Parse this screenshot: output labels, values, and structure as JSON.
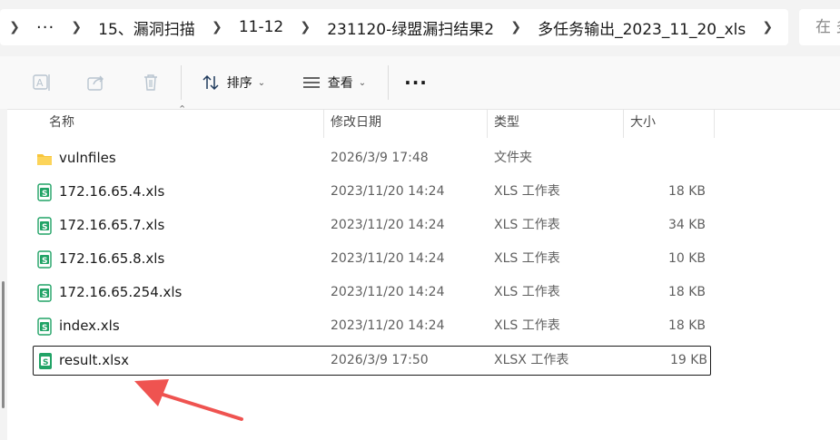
{
  "breadcrumb": {
    "overflow_label": "···",
    "segments": [
      "15、漏洞扫描",
      "11-12",
      "231120-绿盟漏扫结果2",
      "多任务输出_2023_11_20_xls"
    ],
    "search_placeholder": "在 多"
  },
  "toolbar": {
    "sort_label": "排序",
    "view_label": "查看",
    "more_label": "···"
  },
  "columns": {
    "name": "名称",
    "modified": "修改日期",
    "type": "类型",
    "size": "大小"
  },
  "files": [
    {
      "name": "vulnfiles",
      "modified": "2026/3/9 17:48",
      "type": "文件夹",
      "size": "",
      "icon": "folder-icon"
    },
    {
      "name": "172.16.65.4.xls",
      "modified": "2023/11/20 14:24",
      "type": "XLS 工作表",
      "size": "18 KB",
      "icon": "spreadsheet-icon"
    },
    {
      "name": "172.16.65.7.xls",
      "modified": "2023/11/20 14:24",
      "type": "XLS 工作表",
      "size": "34 KB",
      "icon": "spreadsheet-icon"
    },
    {
      "name": "172.16.65.8.xls",
      "modified": "2023/11/20 14:24",
      "type": "XLS 工作表",
      "size": "10 KB",
      "icon": "spreadsheet-icon"
    },
    {
      "name": "172.16.65.254.xls",
      "modified": "2023/11/20 14:24",
      "type": "XLS 工作表",
      "size": "18 KB",
      "icon": "spreadsheet-icon"
    },
    {
      "name": "index.xls",
      "modified": "2023/11/20 14:24",
      "type": "XLS 工作表",
      "size": "18 KB",
      "icon": "spreadsheet-icon"
    },
    {
      "name": "result.xlsx",
      "modified": "2026/3/9 17:50",
      "type": "XLSX 工作表",
      "size": "19 KB",
      "icon": "spreadsheet-icon",
      "selected": true
    }
  ],
  "colors": {
    "annotation_arrow": "#ef5350",
    "spreadsheet_green": "#21a366",
    "folder_yellow": "#f8c53a"
  }
}
